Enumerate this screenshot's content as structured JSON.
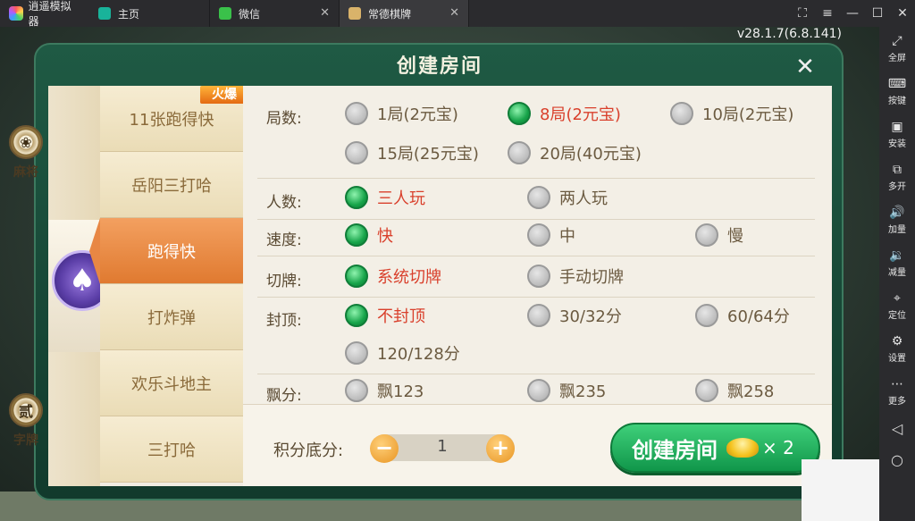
{
  "titlebar": {
    "app_name": "逍遥模拟器",
    "tabs": [
      {
        "label": "主页",
        "icon": "home-tab-icon"
      },
      {
        "label": "微信",
        "icon": "wechat-icon"
      },
      {
        "label": "常德棋牌",
        "icon": "game-app-icon"
      }
    ],
    "tab_close": "✕",
    "window_controls": {
      "fullscreen": "⛶",
      "menu": "≡",
      "minimize": "—",
      "maximize": "☐",
      "close": "✕"
    }
  },
  "version": "v28.1.7(6.8.141)",
  "sidebar": {
    "items": [
      {
        "label": "全屏",
        "icon": "⤢"
      },
      {
        "label": "按键",
        "icon": "⌨"
      },
      {
        "label": "安装",
        "icon": "▣"
      },
      {
        "label": "多开",
        "icon": "⧉"
      },
      {
        "label": "加量",
        "icon": "🔊"
      },
      {
        "label": "减量",
        "icon": "🔉"
      },
      {
        "label": "定位",
        "icon": "⌖"
      },
      {
        "label": "设置",
        "icon": "⚙"
      },
      {
        "label": "更多",
        "icon": "⋯"
      }
    ],
    "nav": {
      "back": "◁",
      "home": "○"
    }
  },
  "dialog": {
    "title": "创建房间",
    "close": "✕",
    "hot_badge": "火爆",
    "categories": [
      {
        "label": "麻将",
        "glyph": "❀"
      },
      {
        "label": "字牌",
        "glyph": "贰"
      }
    ],
    "spade": "♠",
    "games": [
      "11张跑得快",
      "岳阳三打哈",
      "跑得快",
      "打炸弹",
      "欢乐斗地主",
      "三打哈"
    ],
    "active_game_index": 2,
    "rows": [
      {
        "label": "局数:",
        "options": [
          "1局(2元宝)",
          "8局(2元宝)",
          "10局(2元宝)",
          "15局(25元宝)",
          "20局(40元宝)"
        ],
        "selected": "8局(2元宝)"
      },
      {
        "label": "人数:",
        "options": [
          "三人玩",
          "两人玩"
        ],
        "selected": "三人玩"
      },
      {
        "label": "速度:",
        "options": [
          "快",
          "中",
          "慢"
        ],
        "selected": "快"
      },
      {
        "label": "切牌:",
        "options": [
          "系统切牌",
          "手动切牌"
        ],
        "selected": "系统切牌"
      },
      {
        "label": "封顶:",
        "options": [
          "不封顶",
          "30/32分",
          "60/64分",
          "120/128分"
        ],
        "selected": "不封顶"
      },
      {
        "label": "飘分:",
        "options": [
          "飘123",
          "飘235",
          "飘258"
        ],
        "selected": null
      }
    ],
    "score": {
      "label": "积分底分:",
      "value": "1",
      "minus": "−",
      "plus": "+"
    },
    "create_button": {
      "label": "创建房间",
      "cost": "× 2"
    }
  }
}
